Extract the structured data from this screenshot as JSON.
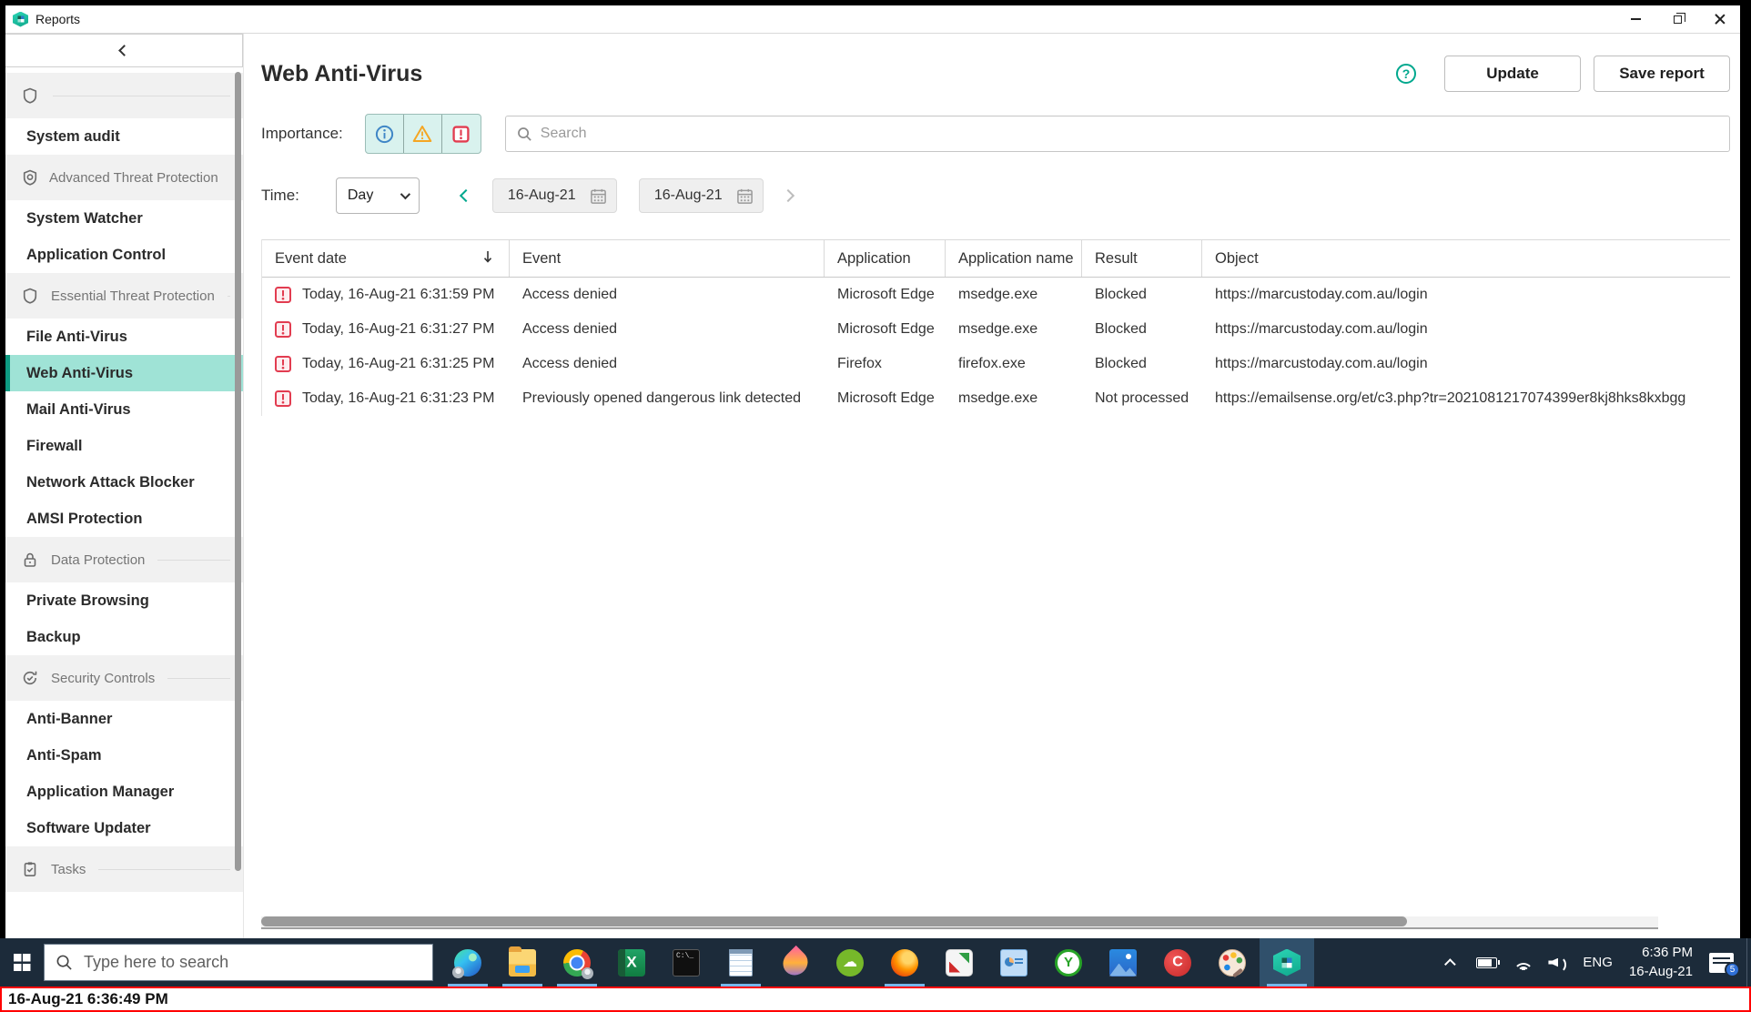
{
  "window": {
    "title": "Reports"
  },
  "sidebar": {
    "entries": [
      {
        "type": "section",
        "icon": "shield-icon",
        "label": ""
      },
      {
        "type": "item",
        "label": "System audit"
      },
      {
        "type": "section",
        "icon": "shield-badge-icon",
        "label": "Advanced Threat Protection"
      },
      {
        "type": "item",
        "label": "System Watcher"
      },
      {
        "type": "item",
        "label": "Application Control"
      },
      {
        "type": "section",
        "icon": "shield-icon",
        "label": "Essential Threat Protection"
      },
      {
        "type": "item",
        "label": "File Anti-Virus"
      },
      {
        "type": "item",
        "label": "Web Anti-Virus",
        "selected": true
      },
      {
        "type": "item",
        "label": "Mail Anti-Virus"
      },
      {
        "type": "item",
        "label": "Firewall"
      },
      {
        "type": "item",
        "label": "Network Attack Blocker"
      },
      {
        "type": "item",
        "label": "AMSI Protection"
      },
      {
        "type": "section",
        "icon": "lock-icon",
        "label": "Data Protection"
      },
      {
        "type": "item",
        "label": "Private Browsing"
      },
      {
        "type": "item",
        "label": "Backup"
      },
      {
        "type": "section",
        "icon": "refresh-shield-icon",
        "label": "Security Controls"
      },
      {
        "type": "item",
        "label": "Anti-Banner"
      },
      {
        "type": "item",
        "label": "Anti-Spam"
      },
      {
        "type": "item",
        "label": "Application Manager"
      },
      {
        "type": "item",
        "label": "Software Updater"
      },
      {
        "type": "section",
        "icon": "tasks-icon",
        "label": "Tasks"
      }
    ]
  },
  "main": {
    "title": "Web Anti-Virus",
    "update_button": "Update",
    "save_report_button": "Save report",
    "importance_label": "Importance:",
    "importance_filters": [
      "information",
      "warning",
      "critical"
    ],
    "search_placeholder": "Search",
    "time_label": "Time:",
    "time_period": "Day",
    "date_from": "16-Aug-21",
    "date_to": "16-Aug-21",
    "table": {
      "columns": [
        "Event date",
        "Event",
        "Application",
        "Application name",
        "Result",
        "Object"
      ],
      "sorted_column": "Event date",
      "rows": [
        {
          "severity": "critical",
          "date": "Today, 16-Aug-21 6:31:59 PM",
          "event": "Access denied",
          "application": "Microsoft Edge",
          "application_name": "msedge.exe",
          "result": "Blocked",
          "object": "https://marcustoday.com.au/login"
        },
        {
          "severity": "critical",
          "date": "Today, 16-Aug-21 6:31:27 PM",
          "event": "Access denied",
          "application": "Microsoft Edge",
          "application_name": "msedge.exe",
          "result": "Blocked",
          "object": "https://marcustoday.com.au/login"
        },
        {
          "severity": "critical",
          "date": "Today, 16-Aug-21 6:31:25 PM",
          "event": "Access denied",
          "application": "Firefox",
          "application_name": "firefox.exe",
          "result": "Blocked",
          "object": "https://marcustoday.com.au/login"
        },
        {
          "severity": "critical",
          "date": "Today, 16-Aug-21 6:31:23 PM",
          "event": "Previously opened dangerous link detected",
          "application": "Microsoft Edge",
          "application_name": "msedge.exe",
          "result": "Not processed",
          "object": "https://emailsense.org/et/c3.php?tr=2021081217074399er8kj8hks8kxbgg"
        }
      ]
    }
  },
  "taskbar": {
    "search_placeholder": "Type here to search",
    "apps": [
      {
        "id": "edge",
        "running": true
      },
      {
        "id": "file-explorer",
        "running": true
      },
      {
        "id": "chrome",
        "running": true
      },
      {
        "id": "excel",
        "running": false
      },
      {
        "id": "terminal",
        "running": false
      },
      {
        "id": "notepad",
        "running": true
      },
      {
        "id": "paint-3d",
        "running": false
      },
      {
        "id": "backup-cloud",
        "running": false
      },
      {
        "id": "firefox",
        "running": true
      },
      {
        "id": "faststone",
        "running": false
      },
      {
        "id": "presentation",
        "running": false
      },
      {
        "id": "treesize",
        "running": false
      },
      {
        "id": "photos",
        "running": false
      },
      {
        "id": "ccleaner",
        "running": false
      },
      {
        "id": "paint",
        "running": false
      },
      {
        "id": "kaspersky",
        "running": true,
        "active": true
      }
    ],
    "tray": {
      "language": "ENG",
      "time": "6:36 PM",
      "date": "16-Aug-21",
      "notification_count": "5"
    }
  },
  "statusbar": {
    "text": "16-Aug-21 6:36:49 PM"
  }
}
